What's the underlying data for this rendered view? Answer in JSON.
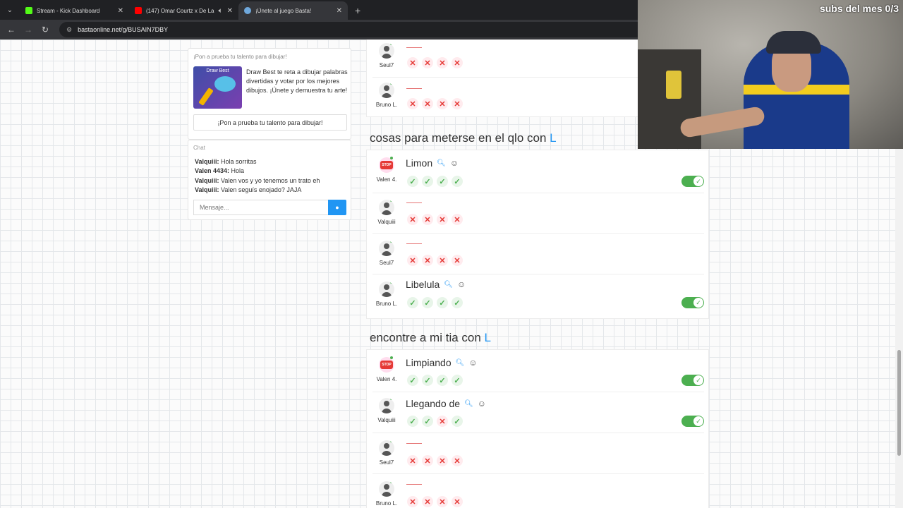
{
  "browser": {
    "tabs": [
      {
        "title": "Stream - Kick Dashboard",
        "color": "#53fc18"
      },
      {
        "title": "(147) Omar Courtz x De La",
        "color": "#ff0000"
      },
      {
        "title": "¡Únete al juego Basta!",
        "color": "#6fa8dc"
      }
    ],
    "url": "bastaonline.net/g/BUSAIN7DBY"
  },
  "promo": {
    "header": "¡Pon a prueba tu talento para dibujar!",
    "image_label": "Draw Best",
    "text": "Draw Best te reta a dibujar palabras divertidas y votar por los mejores dibujos. ¡Únete y demuestra tu arte!",
    "button": "¡Pon a prueba tu talento para dibujar!"
  },
  "chat": {
    "header": "Chat",
    "messages": [
      {
        "user": "Valquiii:",
        "text": " Hola sorritas"
      },
      {
        "user": "Valen 4434:",
        "text": " Hola"
      },
      {
        "user": "Valquiii:",
        "text": " Valen vos y yo tenemos un trato eh"
      },
      {
        "user": "Valquiii:",
        "text": " Valen seguís enojado? JAJA"
      }
    ],
    "input_placeholder": "Mensaje..."
  },
  "section0": {
    "rows": [
      {
        "user": "Seul7"
      },
      {
        "user": "Bruno L."
      }
    ]
  },
  "section1": {
    "title": "cosas para meterse en el qlo con",
    "letter": "L",
    "rows": [
      {
        "user": "Valen 4.",
        "answer": "Limon"
      },
      {
        "user": "Valquiii"
      },
      {
        "user": "Seul7"
      },
      {
        "user": "Bruno L.",
        "answer": "Libelula"
      }
    ]
  },
  "section2": {
    "title": "encontre a mi tia con",
    "letter": "L",
    "rows": [
      {
        "user": "Valen 4.",
        "answer": "Limpiando"
      },
      {
        "user": "Valquiii",
        "answer": "Llegando de"
      },
      {
        "user": "Seul7"
      },
      {
        "user": "Bruno L."
      }
    ]
  },
  "overlay": {
    "subs": "subs del mes 0/3"
  }
}
